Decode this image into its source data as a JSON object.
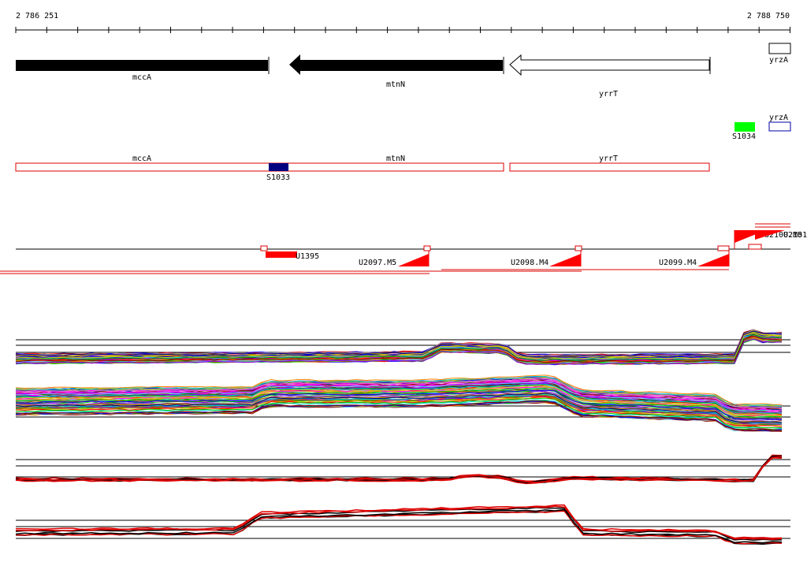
{
  "ruler": {
    "start_label": "2 786 251",
    "end_label": "2 788 750"
  },
  "genes": [
    {
      "name": "mccA",
      "strand": "forward",
      "fill": "#000000"
    },
    {
      "name": "mtnN",
      "strand": "reverse",
      "fill": "#000000"
    },
    {
      "name": "yrrT",
      "strand": "reverse",
      "fill": "#ffffff"
    },
    {
      "name": "yrzA",
      "strand": "forward",
      "fill": "#ffffff"
    }
  ],
  "small_features": [
    {
      "name": "S1034",
      "color": "#00ff00"
    },
    {
      "name": "yrzA",
      "color": "#0000aa"
    }
  ],
  "transcripts": [
    {
      "name": "mccA"
    },
    {
      "name": "mtnN"
    },
    {
      "name": "yrrT"
    }
  ],
  "transcript_marker": {
    "name": "S1033",
    "color": "#000080"
  },
  "upshifts": [
    {
      "name": "U1395"
    },
    {
      "name": "U2097.M5"
    },
    {
      "name": "U2098.M4"
    },
    {
      "name": "U2099.M4"
    },
    {
      "name": "U2100.M5"
    },
    {
      "name": "U2101"
    }
  ],
  "colors": {
    "gene_outline": "#000000",
    "transcript_outline": "#dd0000",
    "upshift": "#ff0000",
    "profile_line": "#000000"
  },
  "profile_palette": [
    "#ff0000",
    "#00cc00",
    "#0000ff",
    "#ff00ff",
    "#00cccc",
    "#cccc00",
    "#ff8800",
    "#8800ff",
    "#008800",
    "#880000",
    "#000088",
    "#ff66cc",
    "#66ccff",
    "#999999",
    "#aa6600"
  ]
}
